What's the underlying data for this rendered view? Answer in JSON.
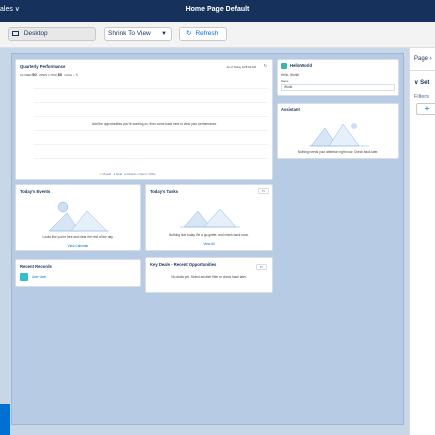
{
  "topbar": {
    "left_text": "ales ∨",
    "title": "Home Page Default"
  },
  "toolbar": {
    "device": "Desktop",
    "view": "Shrink To View",
    "refresh": "Refresh"
  },
  "perf": {
    "title": "Quarterly Performance",
    "asof": "As of Today 9:25:02 AM",
    "closed_label": "CLOSED",
    "closed_value": "$0",
    "open_label": "OPEN (>70%)",
    "open_value": "$0",
    "goal_label": "GOAL --",
    "message": "Add the opportunities you're working on, then come back here to view your performance.",
    "legend": [
      "Closed",
      "Goal",
      "Closed + Open (>70%)"
    ]
  },
  "helloworld": {
    "title": "HelloWorld",
    "greeting": "Hello, World!",
    "name_label": "Name",
    "name_value": "World"
  },
  "assistant": {
    "title": "Assistant",
    "message": "Nothing needs your attention right now. Check back later."
  },
  "events": {
    "title": "Today's Events",
    "message": "Looks like you're free and clear the rest of the day.",
    "link": "View Calendar"
  },
  "tasks": {
    "title": "Today's Tasks",
    "message": "Nothing due today. Be a go-getter, and check back soon.",
    "link": "View All"
  },
  "records": {
    "title": "Recent Records",
    "item": "User User"
  },
  "deals": {
    "title": "Key Deals - Recent Opportunities",
    "message": "No deals yet. Select another filter or check back later."
  },
  "panel": {
    "page": "Page",
    "section": "Set",
    "filters": "Filters",
    "add": "+"
  }
}
